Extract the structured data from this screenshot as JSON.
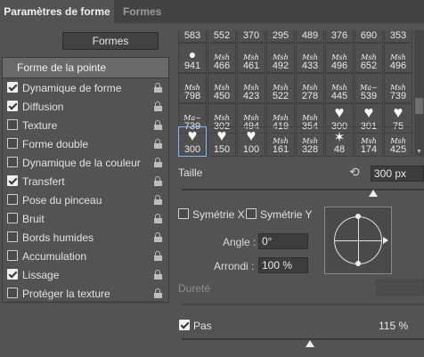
{
  "tabs": {
    "active": "Paramètres de forme",
    "inactive": "Formes"
  },
  "formes_button": "Formes",
  "left_panel": {
    "header": "Forme de la pointe",
    "items": [
      {
        "label": "Dynamique de forme",
        "checked": true,
        "locked": true
      },
      {
        "label": "Diffusion",
        "checked": true,
        "locked": true
      },
      {
        "label": "Texture",
        "checked": false,
        "locked": true
      },
      {
        "label": "Forme double",
        "checked": false,
        "locked": true
      },
      {
        "label": "Dynamique de la couleur",
        "checked": false,
        "locked": true
      },
      {
        "label": "Transfert",
        "checked": true,
        "locked": true
      },
      {
        "label": "Pose du pinceau",
        "checked": false,
        "locked": true
      },
      {
        "label": "Bruit",
        "checked": false,
        "locked": true
      },
      {
        "label": "Bords humides",
        "checked": false,
        "locked": true
      },
      {
        "label": "Accumulation",
        "checked": false,
        "locked": true
      },
      {
        "label": "Lissage",
        "checked": true,
        "locked": true
      },
      {
        "label": "Protéger la texture",
        "checked": false,
        "locked": true
      }
    ]
  },
  "brush_grid": {
    "columns": 8,
    "rows": [
      [
        "583",
        "552",
        "370",
        "295",
        "489",
        "376",
        "690",
        "353"
      ],
      [
        "941",
        "466",
        "461",
        "492",
        "433",
        "496",
        "652",
        "496"
      ],
      [
        "798",
        "450",
        "423",
        "522",
        "278",
        "445",
        "539",
        "739"
      ],
      [
        "739",
        "302",
        "494",
        "419",
        "354",
        "300",
        "301",
        "75"
      ],
      [
        "300",
        "150",
        "100",
        "161",
        "328",
        "48",
        "174",
        "425"
      ]
    ],
    "preview_rows": [
      [
        "",
        "",
        "",
        "",
        "",
        "",
        "",
        ""
      ],
      [
        "dot",
        "script",
        "script",
        "script",
        "script",
        "script",
        "script",
        "script"
      ],
      [
        "script",
        "script",
        "script",
        "script",
        "script",
        "script",
        "bold",
        "script"
      ],
      [
        "bold",
        "script",
        "script",
        "script",
        "script",
        "heart",
        "heart",
        "heart"
      ],
      [
        "heart",
        "heart",
        "heart",
        "script",
        "script",
        "star",
        "script",
        "script"
      ]
    ],
    "selected": "300"
  },
  "taille": {
    "label": "Taille",
    "value": "300 px",
    "slider_fraction": 0.79
  },
  "symetrie_x": {
    "label": "Symétrie X",
    "checked": false
  },
  "symetrie_y": {
    "label": "Symétrie Y",
    "checked": false
  },
  "angle": {
    "label": "Angle :",
    "value": "0°"
  },
  "arrondi": {
    "label": "Arrondi :",
    "value": "100 %"
  },
  "durete": {
    "label": "Dureté",
    "value": ""
  },
  "pas": {
    "label": "Pas",
    "checked": true,
    "value": "115 %",
    "slider_fraction": 0.53
  },
  "icons": {
    "reset": "reset-icon",
    "lock": "lock-icon",
    "check": "check-icon"
  }
}
